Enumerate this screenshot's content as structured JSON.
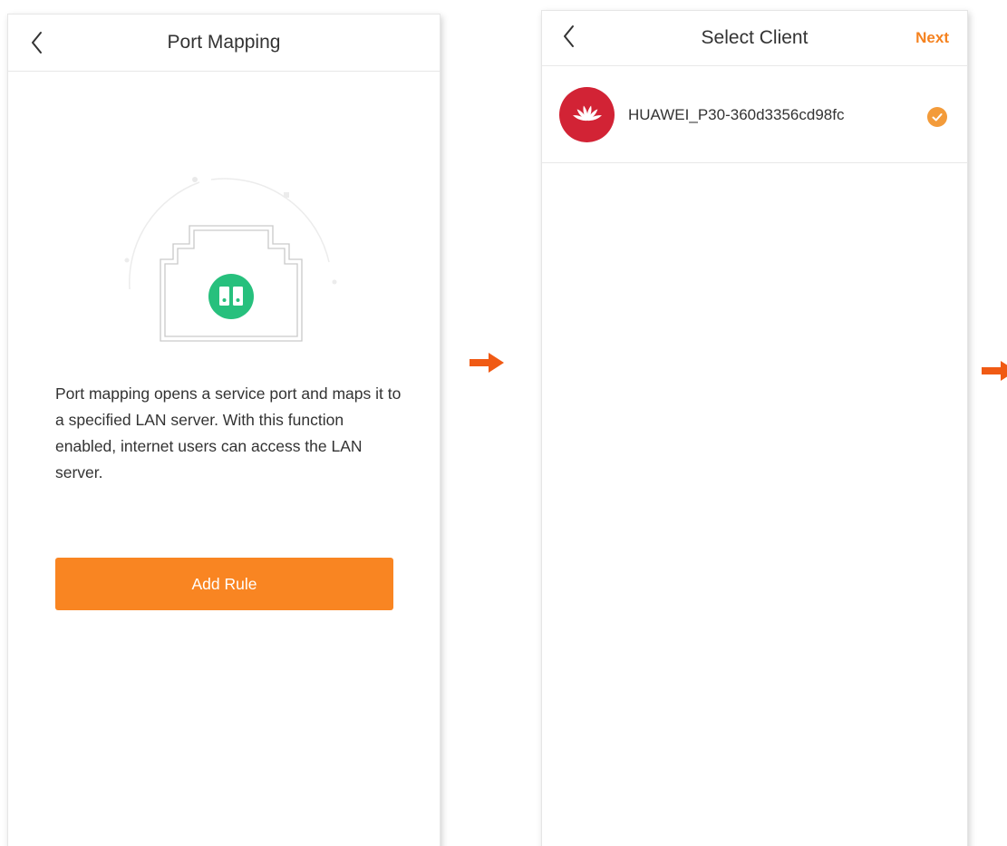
{
  "screen1": {
    "title": "Port Mapping",
    "back_icon": "chevron-left-icon",
    "illustration_icon": "lan-port-icon",
    "description": "Port mapping opens a service port and maps it to a specified LAN server. With this function enabled, internet users can access the LAN server.",
    "add_rule_label": "Add Rule"
  },
  "screen2": {
    "title": "Select Client",
    "back_icon": "chevron-left-icon",
    "next_label": "Next",
    "clients": [
      {
        "name": "HUAWEI_P30-360d3356cd98fc",
        "brand_icon": "huawei-logo-icon",
        "selected": true
      }
    ]
  },
  "flow_arrow_icon": "arrow-right-icon",
  "colors": {
    "accent": "#f98522",
    "next_text": "#f5821f",
    "check": "#f39b3a",
    "brand_red": "#d22335",
    "port_green": "#27c07d",
    "arrow": "#f05a14"
  }
}
